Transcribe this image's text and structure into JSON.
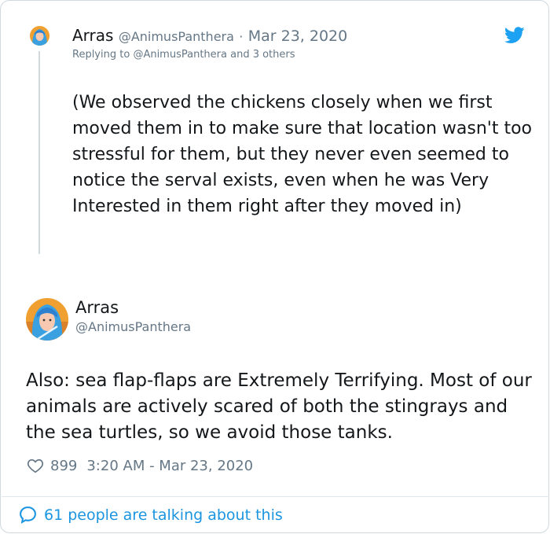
{
  "reply": {
    "name": "Arras",
    "handle": "@AnimusPanthera",
    "separator": "·",
    "date": "Mar 23, 2020",
    "replying_prefix": "Replying to",
    "replying_mention": "@AnimusPanthera",
    "replying_suffix": "and 3 others",
    "text": "(We observed the chickens closely when we first moved them in to make sure that location wasn't too stressful for them, but they never even seemed to notice the serval exists, even when he was Very Interested in them right after they moved in)"
  },
  "tweet": {
    "name": "Arras",
    "handle": "@AnimusPanthera",
    "text": "Also: sea flap-flaps are Extremely Terrifying. Most of our animals are actively scared of both the stingrays and the sea turtles, so we avoid those tanks.",
    "like_count": "899",
    "timestamp": "3:20 AM - Mar 23, 2020"
  },
  "footer": {
    "talking_text": "61 people are talking about this"
  },
  "icons": {
    "bird": "twitter-bird-icon",
    "heart": "heart-icon",
    "bubble": "speech-bubble-icon"
  },
  "colors": {
    "brand": "#1da1f2",
    "link": "#1b95e0",
    "secondary_text": "#657786",
    "text": "#14171a",
    "border": "#cfd9de"
  }
}
